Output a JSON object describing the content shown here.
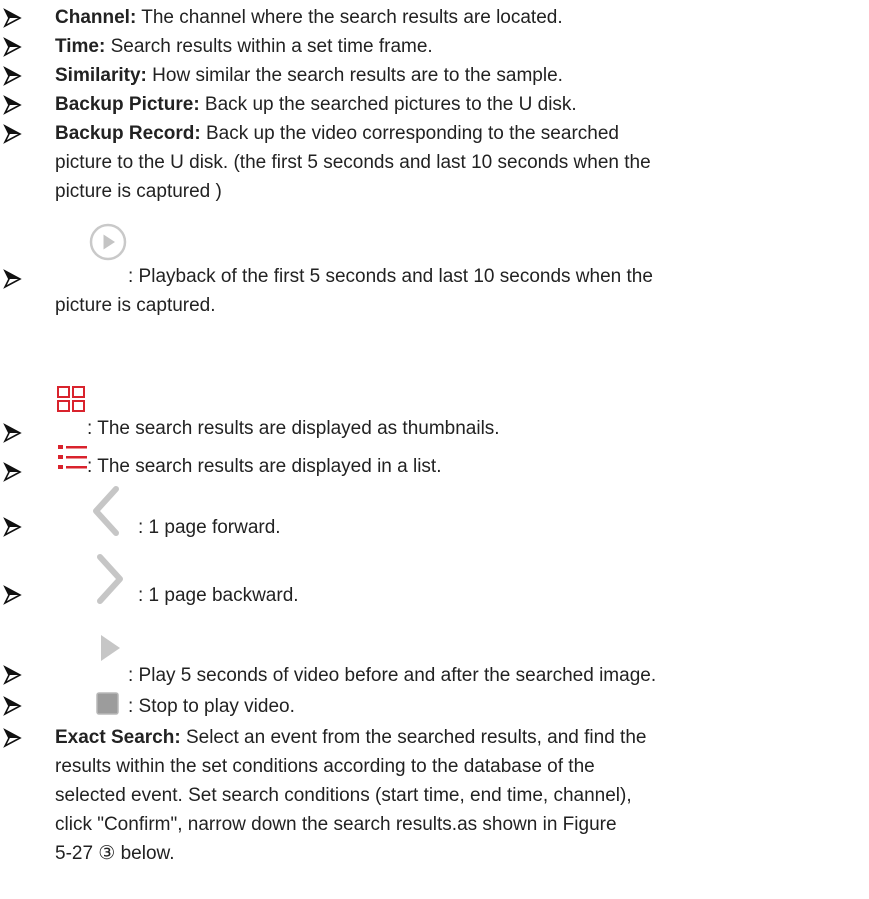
{
  "items": [
    {
      "term": "Channel:",
      "desc": " The channel where the search results are located."
    },
    {
      "term": "Time:",
      "desc": " Search results within a set time frame."
    },
    {
      "term": "Similarity:",
      "desc": " How similar the search results are to the sample."
    },
    {
      "term": "Backup Picture:",
      "desc": " Back up the searched pictures to the U disk."
    },
    {
      "term": "Backup Record:",
      "desc": " Back up the video corresponding to the searched",
      "cont": [
        "picture to the U disk. (the first 5 seconds and last 10 seconds when the",
        "picture is captured )"
      ]
    }
  ],
  "icon_items": [
    {
      "icon": "play-circle-icon",
      "desc": ": Playback of the first 5 seconds and last 10 seconds when the",
      "cont": "picture is captured."
    },
    {
      "icon": "thumbnail-grid-icon",
      "desc": ": The search results are displayed as thumbnails."
    },
    {
      "icon": "list-view-icon",
      "desc": ": The search results are displayed in a list."
    },
    {
      "icon": "chevron-left-icon",
      "desc": ": 1 page forward."
    },
    {
      "icon": "chevron-right-icon",
      "desc": ": 1 page backward."
    },
    {
      "icon": "play-triangle-icon",
      "desc": ": Play 5 seconds of video before and after the searched image."
    },
    {
      "icon": "stop-square-icon",
      "desc": ": Stop to play video."
    }
  ],
  "exact_search": {
    "term": "Exact Search:",
    "desc": " Select an event from the searched results, and find the",
    "lines": [
      "results within the set conditions according to the database of the",
      "selected event. Set search conditions (start time, end time, channel),",
      "click \"Confirm\", narrow down the search results.as shown in Figure",
      "5-27 ③ below."
    ]
  },
  "colors": {
    "accent_red": "#d9232d",
    "icon_gray": "#b8b8b8"
  }
}
